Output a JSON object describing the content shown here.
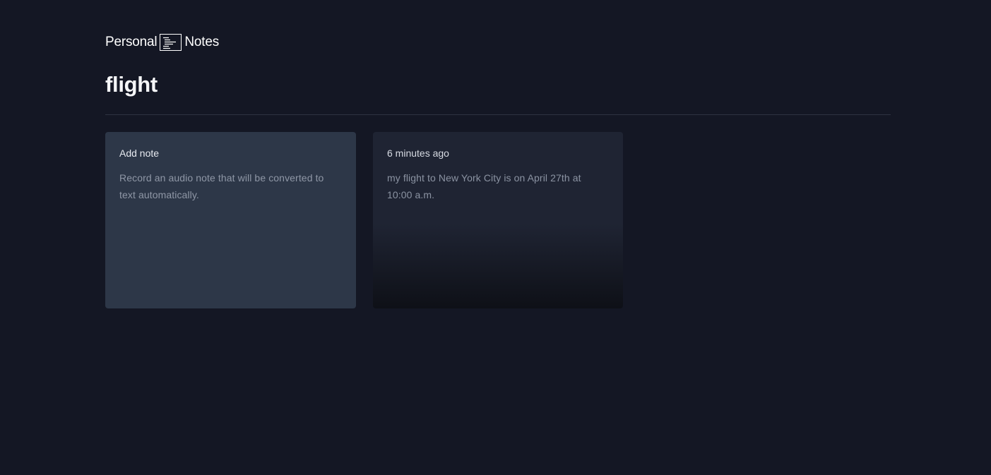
{
  "header": {
    "logo_left": "Personal",
    "logo_right": "Notes",
    "logo_icon": "notes-icon"
  },
  "search": {
    "query": "flight"
  },
  "cards": {
    "add": {
      "title": "Add note",
      "description": "Record an audio note that will be converted to text automatically."
    },
    "notes": [
      {
        "time": "6 minutes ago",
        "text": "my flight to New York City is on April 27th at 10:00 a.m."
      }
    ]
  },
  "colors": {
    "background": "#141724",
    "add_card": "#2d3748",
    "note_card": "#1f2433",
    "divider": "#2e3342"
  }
}
